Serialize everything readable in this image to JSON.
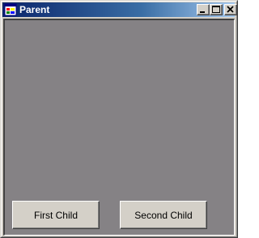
{
  "window": {
    "title": "Parent",
    "icon": "app-window-icon"
  },
  "caption_buttons": {
    "minimize": "minimize-icon",
    "maximize": "maximize-icon",
    "close": "close-icon"
  },
  "buttons": {
    "first_child": "First Child",
    "second_child": "Second Child"
  },
  "colors": {
    "titlebar_start": "#0a246a",
    "titlebar_end": "#a6caf0",
    "client_background": "#858285",
    "button_face": "#d4d0c8"
  }
}
